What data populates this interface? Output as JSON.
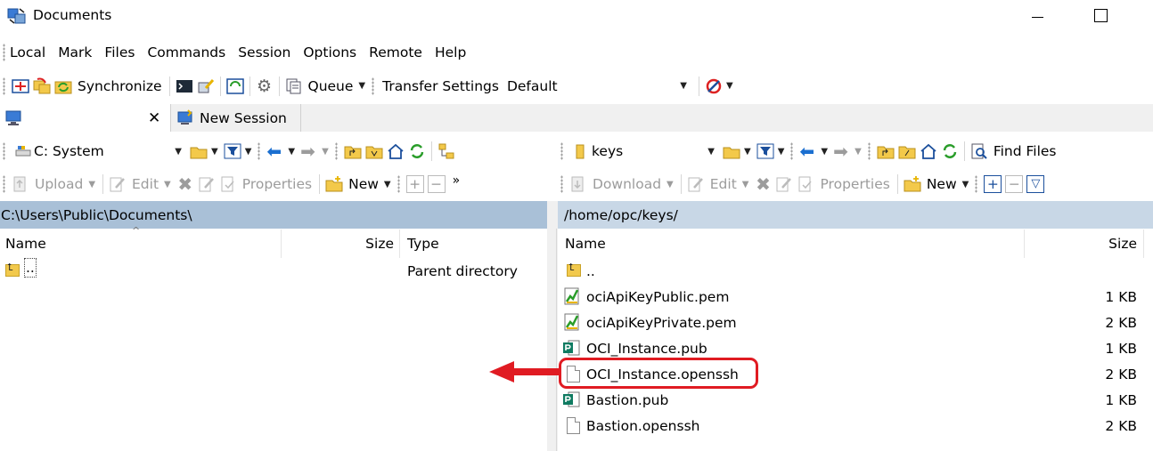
{
  "window": {
    "title": "Documents"
  },
  "menu": [
    "Local",
    "Mark",
    "Files",
    "Commands",
    "Session",
    "Options",
    "Remote",
    "Help"
  ],
  "toolbar": {
    "synchronize": "Synchronize",
    "queue": "Queue",
    "transfer_settings": "Transfer Settings",
    "transfer_preset": "Default"
  },
  "tabs": {
    "new_session": "New Session"
  },
  "left": {
    "drive": "C: System",
    "upload": "Upload",
    "edit": "Edit",
    "properties": "Properties",
    "new": "New",
    "path": "C:\\Users\\Public\\Documents\\",
    "columns": {
      "name": "Name",
      "size": "Size",
      "type": "Type"
    },
    "files": [
      {
        "name": "..",
        "size": "",
        "type": "Parent directory"
      }
    ]
  },
  "right": {
    "dir": "keys",
    "find_files": "Find Files",
    "download": "Download",
    "edit": "Edit",
    "properties": "Properties",
    "new": "New",
    "path": "/home/opc/keys/",
    "columns": {
      "name": "Name",
      "size": "Size"
    },
    "files": [
      {
        "name": "..",
        "size": ""
      },
      {
        "name": "ociApiKeyPublic.pem",
        "size": "1 KB"
      },
      {
        "name": "ociApiKeyPrivate.pem",
        "size": "2 KB"
      },
      {
        "name": "OCI_Instance.pub",
        "size": "1 KB"
      },
      {
        "name": "OCI_Instance.openssh",
        "size": "2 KB"
      },
      {
        "name": "Bastion.pub",
        "size": "1 KB"
      },
      {
        "name": "Bastion.openssh",
        "size": "2 KB"
      }
    ]
  },
  "colors": {
    "annotation": "#e01b22",
    "left_path_bar": "#a9c0d7",
    "right_path_bar": "#c8d7e6"
  }
}
